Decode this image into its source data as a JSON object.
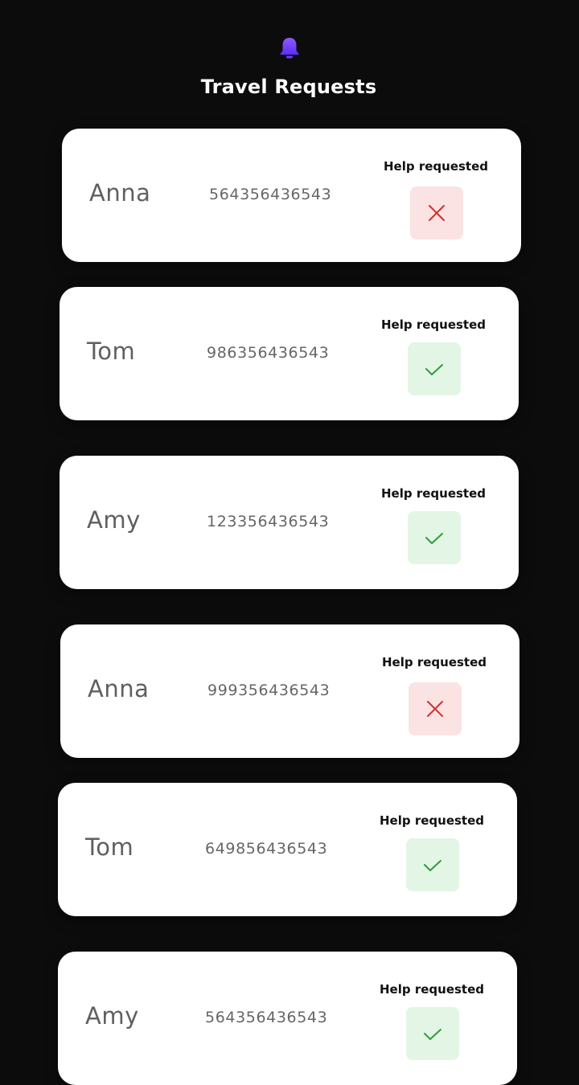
{
  "header": {
    "icon": "bell-icon",
    "title": "Travel Requests",
    "accent_color": "#7c4dff"
  },
  "requests": [
    {
      "name": "Anna",
      "number": "564356436543",
      "help_label": "Help requested",
      "status": "declined",
      "status_icon": "close-icon"
    },
    {
      "name": "Tom",
      "number": "986356436543",
      "help_label": "Help requested",
      "status": "approved",
      "status_icon": "check-icon"
    },
    {
      "name": "Amy",
      "number": "123356436543",
      "help_label": "Help requested",
      "status": "approved",
      "status_icon": "check-icon"
    },
    {
      "name": "Anna",
      "number": "999356436543",
      "help_label": "Help requested",
      "status": "declined",
      "status_icon": "close-icon"
    },
    {
      "name": "Tom",
      "number": "649856436543",
      "help_label": "Help requested",
      "status": "approved",
      "status_icon": "check-icon"
    },
    {
      "name": "Amy",
      "number": "564356436543",
      "help_label": "Help requested",
      "status": "approved",
      "status_icon": "check-icon"
    }
  ],
  "colors": {
    "background": "#0c0c0c",
    "card": "#ffffff",
    "declined_bg": "#fbe3e3",
    "declined_icon": "#d32f2f",
    "approved_bg": "#e3f5e4",
    "approved_icon": "#2e9e3a"
  }
}
